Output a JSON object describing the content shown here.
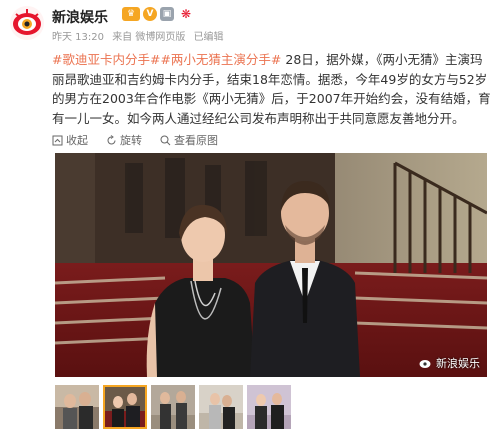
{
  "post": {
    "username": "新浪娱乐",
    "time": "昨天 13:20",
    "source": "来自 微博网页版",
    "edited": "已编辑",
    "topic1": "#歌迪亚卡内分手#",
    "topic2": "#两小无猜主演分手#",
    "body": " 28日，据外媒，《两小无猜》主演玛丽昂歌迪亚和吉约姆卡内分手，结束18年恋情。据悉，今年49岁的女方与52岁的男方在2003年合作电影《两小无猜》后，于2007年开始约会，没有结婚，育有一儿一女。如今两人通过经纪公司发布声明称出于共同意愿友善地分开。"
  },
  "actions": {
    "collect": "收起",
    "rotate": "旋转",
    "view_original": "查看原图"
  },
  "watermark": "新浪娱乐",
  "badges": [
    "vip-crown-icon",
    "v-badge-icon",
    "medal-icon"
  ],
  "colors": {
    "topic": "#eb7350",
    "accent": "#f5a623"
  }
}
